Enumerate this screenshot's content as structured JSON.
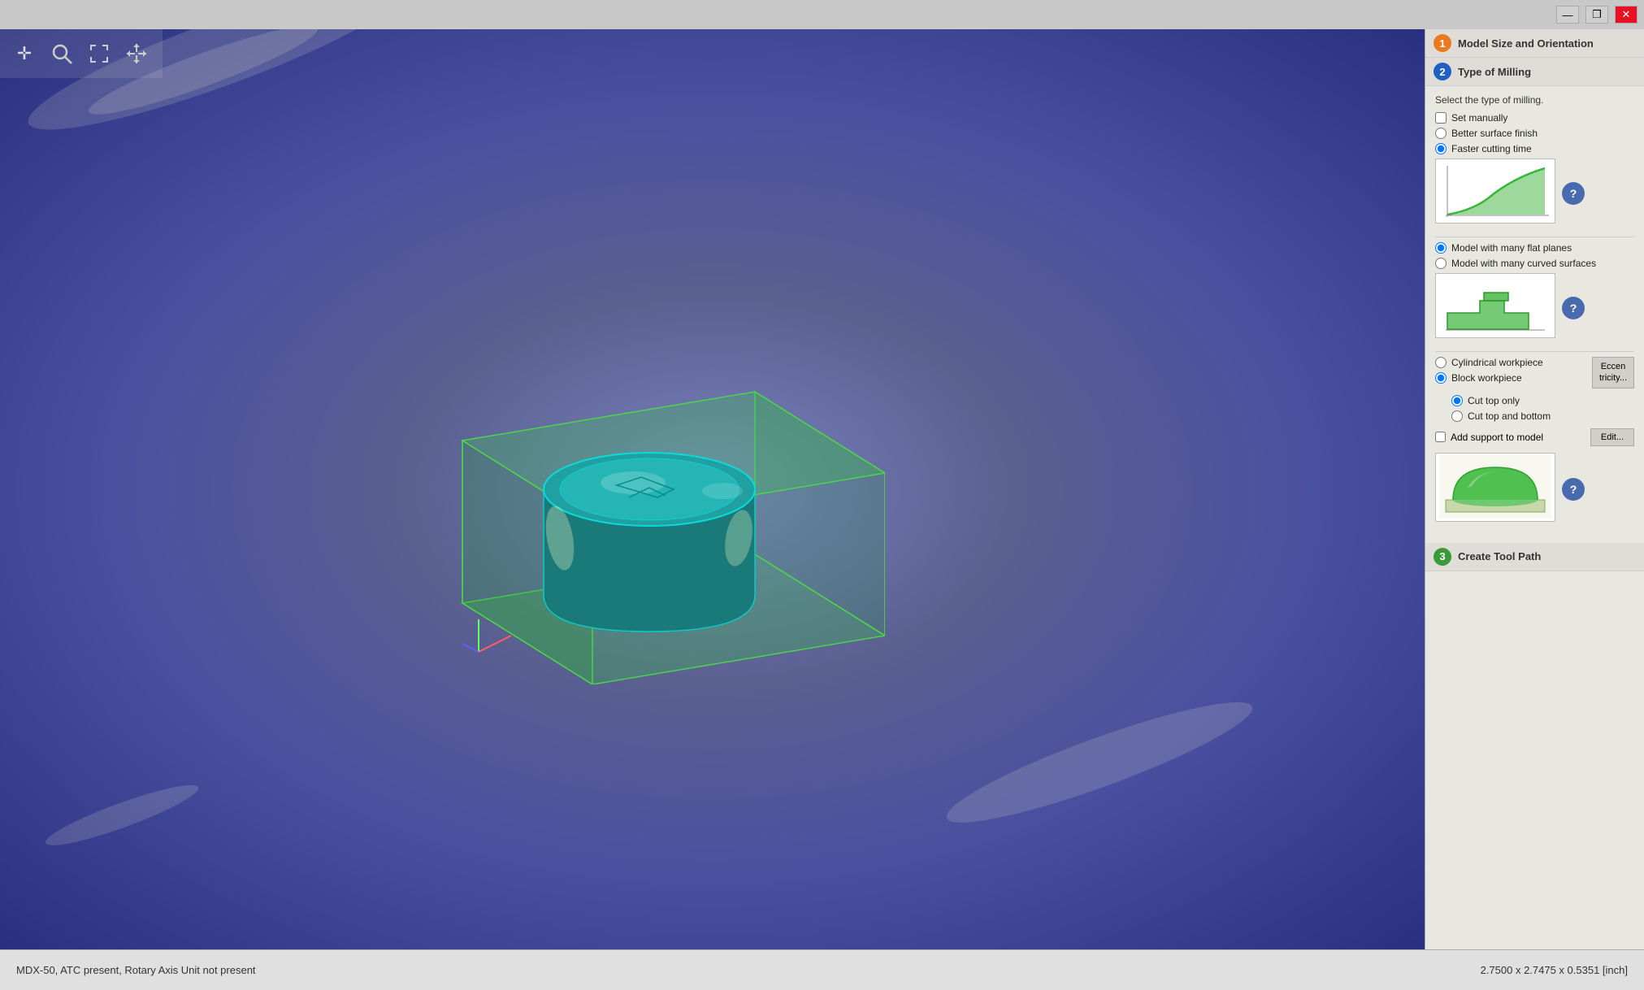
{
  "titlebar": {
    "minimize": "—",
    "maximize": "❐",
    "close": "✕"
  },
  "toolbar": {
    "icons": [
      {
        "name": "move-icon",
        "symbol": "✛"
      },
      {
        "name": "zoom-icon",
        "symbol": "🔍"
      },
      {
        "name": "fit-icon",
        "symbol": "⤢"
      },
      {
        "name": "collapse-icon",
        "symbol": "✦"
      }
    ]
  },
  "right_panel": {
    "step1": {
      "badge": "1",
      "label": "Model Size and Orientation"
    },
    "step2": {
      "badge": "2",
      "label": "Type of Milling",
      "content": {
        "intro": "Select the type of milling.",
        "options": {
          "set_manually": {
            "label": "Set manually",
            "checked": false
          },
          "better_surface": {
            "label": "Better surface finish",
            "checked": false
          },
          "faster_cutting": {
            "label": "Faster cutting time",
            "checked": true
          }
        },
        "surface_options": {
          "flat_planes": {
            "label": "Model with many flat planes",
            "checked": true
          },
          "curved_surfaces": {
            "label": "Model with many curved surfaces",
            "checked": false
          }
        },
        "workpiece": {
          "cylindrical": {
            "label": "Cylindrical workpiece",
            "checked": false
          },
          "block": {
            "label": "Block workpiece",
            "checked": true
          },
          "eccentricity_label": "Eccen\ntricity..."
        },
        "cut_options": {
          "top_only": {
            "label": "Cut top only",
            "checked": true
          },
          "top_and_bottom": {
            "label": "Cut top and bottom",
            "checked": false
          }
        },
        "support": {
          "label": "Add support to model",
          "checked": false,
          "edit_label": "Edit..."
        }
      }
    },
    "step3": {
      "badge": "3",
      "label": "Create Tool Path"
    }
  },
  "status_bar": {
    "machine_info": "MDX-50, ATC present, Rotary Axis Unit not present",
    "dimensions": "2.7500 x 2.7475 x 0.5351 [inch]"
  }
}
